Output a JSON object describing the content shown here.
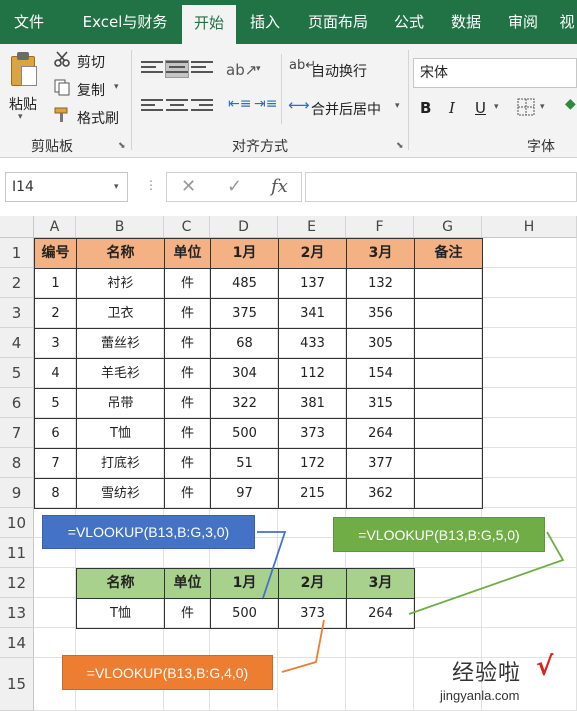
{
  "ribbon_tabs": [
    {
      "label": "文件",
      "active": false
    },
    {
      "label": "Excel与财务",
      "active": false
    },
    {
      "label": "开始",
      "active": true
    },
    {
      "label": "插入",
      "active": false
    },
    {
      "label": "页面布局",
      "active": false
    },
    {
      "label": "公式",
      "active": false
    },
    {
      "label": "数据",
      "active": false
    },
    {
      "label": "审阅",
      "active": false
    },
    {
      "label": "视",
      "active": false
    }
  ],
  "clipboard": {
    "paste": "粘贴",
    "cut": "剪切",
    "copy": "复制",
    "format_painter": "格式刷",
    "group_label": "剪贴板"
  },
  "alignment": {
    "wrap_text": "自动换行",
    "merge_center": "合并后居中",
    "group_label": "对齐方式"
  },
  "font": {
    "name": "宋体",
    "bold": "B",
    "italic": "I",
    "underline": "U",
    "group_label": "字体"
  },
  "formula_bar": {
    "name_box": "I14",
    "cancel": "✕",
    "enter": "✓",
    "fx": "fx",
    "formula": ""
  },
  "columns": [
    "A",
    "B",
    "C",
    "D",
    "E",
    "F",
    "G",
    "H"
  ],
  "rows": [
    "1",
    "2",
    "3",
    "4",
    "5",
    "6",
    "7",
    "8",
    "9",
    "10",
    "11",
    "12",
    "13",
    "14",
    "15"
  ],
  "table1": {
    "headers": [
      "编号",
      "名称",
      "单位",
      "1月",
      "2月",
      "3月",
      "备注"
    ],
    "rows": [
      [
        "1",
        "衬衫",
        "件",
        "485",
        "137",
        "132",
        ""
      ],
      [
        "2",
        "卫衣",
        "件",
        "375",
        "341",
        "356",
        ""
      ],
      [
        "3",
        "蕾丝衫",
        "件",
        "68",
        "433",
        "305",
        ""
      ],
      [
        "4",
        "羊毛衫",
        "件",
        "304",
        "112",
        "154",
        ""
      ],
      [
        "5",
        "吊带",
        "件",
        "322",
        "381",
        "315",
        ""
      ],
      [
        "6",
        "T恤",
        "件",
        "500",
        "373",
        "264",
        ""
      ],
      [
        "7",
        "打底衫",
        "件",
        "51",
        "172",
        "377",
        ""
      ],
      [
        "8",
        "雪纺衫",
        "件",
        "97",
        "215",
        "362",
        ""
      ]
    ]
  },
  "table2": {
    "headers": [
      "名称",
      "单位",
      "1月",
      "2月",
      "3月"
    ],
    "row": [
      "T恤",
      "件",
      "500",
      "373",
      "264"
    ]
  },
  "callouts": {
    "blue": {
      "text": "=VLOOKUP(B13,B:G,3,0)",
      "color": "#4472c4"
    },
    "green": {
      "text": "=VLOOKUP(B13,B:G,5,0)",
      "color": "#70ad47"
    },
    "orange": {
      "text": "=VLOOKUP(B13,B:G,4,0)",
      "color": "#ed7d31"
    }
  },
  "watermark": {
    "brand": "经验啦",
    "check": "√",
    "url": "jingyanla.com"
  },
  "colors": {
    "ribbon": "#217346",
    "header_orange": "#f4b183",
    "header_green": "#a9d18e"
  }
}
